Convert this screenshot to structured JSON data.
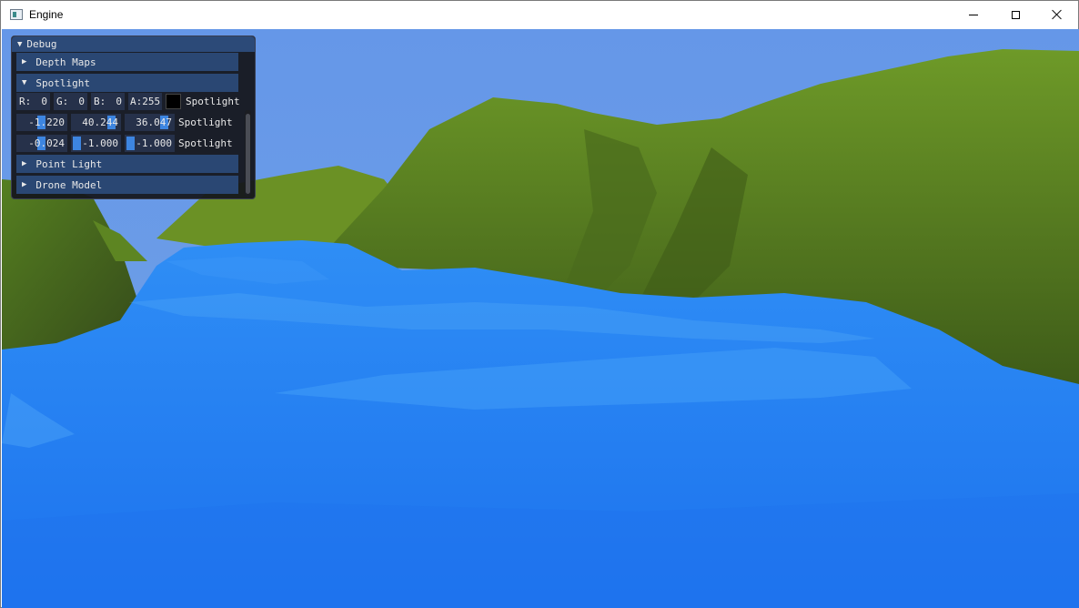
{
  "window": {
    "title": "Engine",
    "icons": {
      "app": "app-window-icon",
      "minimize": "minimize-icon",
      "maximize": "maximize-icon",
      "close": "close-icon"
    }
  },
  "debug_panel": {
    "title": "Debug",
    "sections": {
      "depth_maps": "Depth Maps",
      "spotlight": "Spotlight",
      "point_light": "Point Light",
      "drone_model": "Drone Model"
    },
    "spotlight": {
      "color": {
        "r_label": "R:",
        "r_val": "0",
        "g_label": "G:",
        "g_val": "0",
        "b_label": "B:",
        "b_val": "0",
        "a_label": "A:",
        "a_val": "255",
        "label": "Spotlight",
        "swatch": "#000000"
      },
      "position": {
        "x": "-1.220",
        "y": "40.244",
        "z": "36.047",
        "label": "Spotlight"
      },
      "direction": {
        "x": "-0.024",
        "y": "-1.000",
        "z": "-1.000",
        "label": "Spotlight"
      }
    }
  },
  "colors": {
    "sky": "#6a9ae6",
    "water": "#2a86f5",
    "grass": "#5e8a22",
    "panel_header": "#2c4a78",
    "slider_grab": "#3d85e0"
  }
}
